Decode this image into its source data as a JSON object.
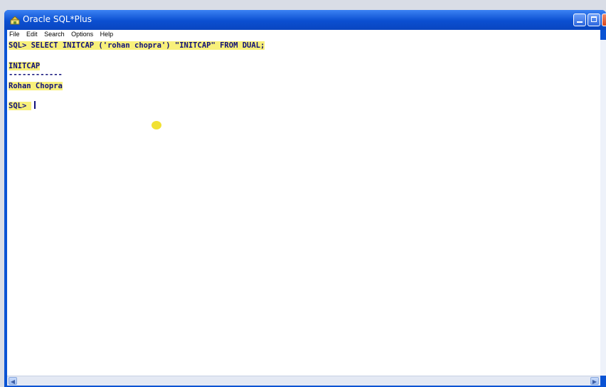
{
  "window": {
    "title": "Oracle SQL*Plus"
  },
  "menu": [
    "File",
    "Edit",
    "Search",
    "Options",
    "Help"
  ],
  "console": {
    "lines": [
      "SQL> SELECT INITCAP ('rohan chopra') \"INITCAP\" FROM DUAL;",
      "INITCAP",
      "------------",
      "Rohan Chopra",
      "SQL> "
    ]
  },
  "icons": {
    "app": "oracle-sqlplus-icon",
    "minimize": "minimize-icon",
    "maximize": "maximize-icon",
    "close": "close-icon",
    "scroll_left": "scroll-left-arrow-icon",
    "scroll_right": "scroll-right-arrow-icon"
  },
  "colors": {
    "titlebar": "#0b4fd1",
    "console_text": "#10107a",
    "highlight": "#f8f07a"
  }
}
